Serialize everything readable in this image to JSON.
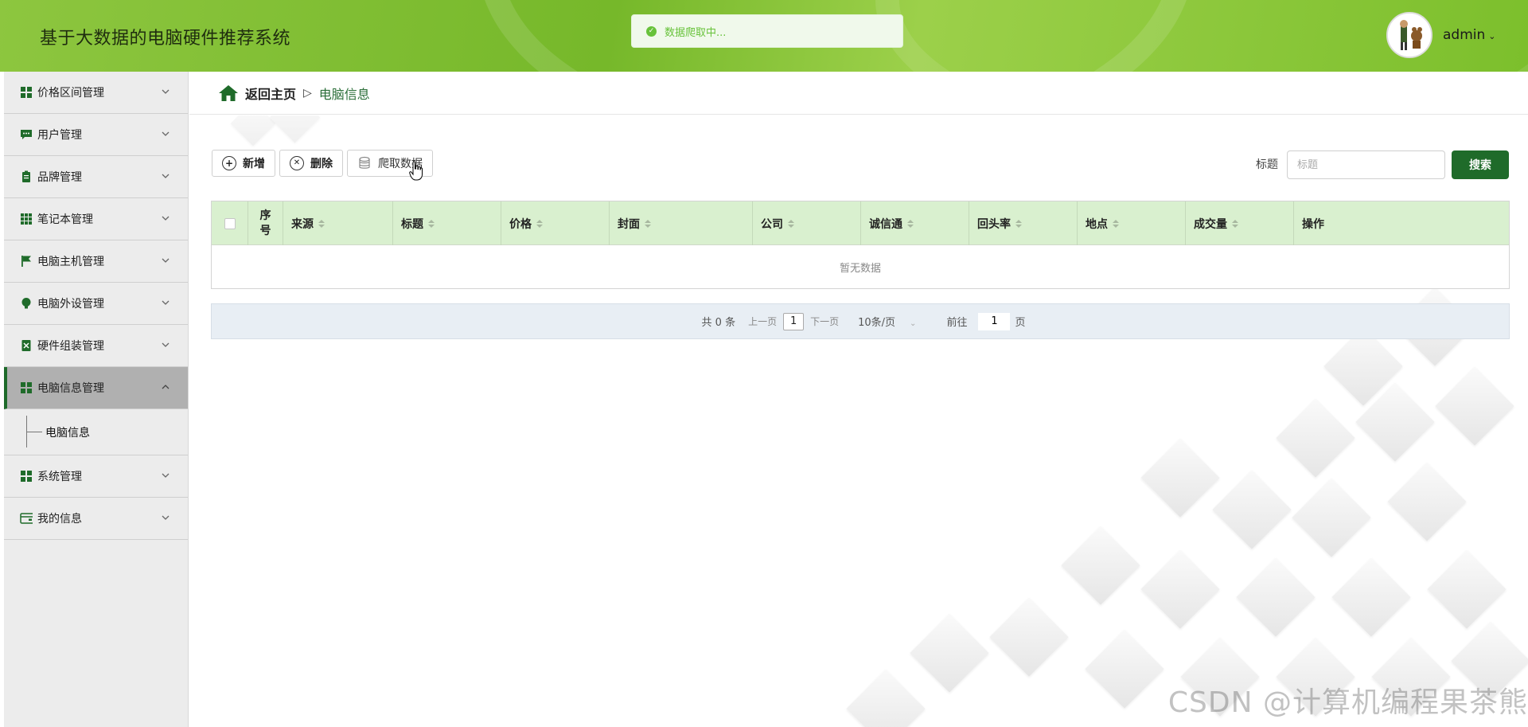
{
  "header": {
    "app_title": "基于大数据的电脑硬件推荐系统",
    "toast": "数据爬取中...",
    "user_name": "admin"
  },
  "sidebar": {
    "items": [
      {
        "label": "价格区间管理",
        "icon": "grid-icon"
      },
      {
        "label": "用户管理",
        "icon": "chat-icon"
      },
      {
        "label": "品牌管理",
        "icon": "clipboard-icon"
      },
      {
        "label": "笔记本管理",
        "icon": "apps-icon"
      },
      {
        "label": "电脑主机管理",
        "icon": "flag-icon"
      },
      {
        "label": "电脑外设管理",
        "icon": "bulb-icon"
      },
      {
        "label": "硬件组装管理",
        "icon": "doc-icon"
      },
      {
        "label": "电脑信息管理",
        "icon": "grid-icon"
      },
      {
        "label": "系统管理",
        "icon": "grid-icon"
      },
      {
        "label": "我的信息",
        "icon": "wallet-icon"
      }
    ],
    "sub_item": "电脑信息"
  },
  "breadcrumb": {
    "home": "返回主页",
    "separator": "▷",
    "current": "电脑信息"
  },
  "toolbar": {
    "add": "新增",
    "delete": "删除",
    "crawl": "爬取数据"
  },
  "search": {
    "label": "标题",
    "placeholder": "标题",
    "button": "搜索"
  },
  "table": {
    "seq_line1": "序",
    "seq_line2": "号",
    "columns": [
      "来源",
      "标题",
      "价格",
      "封面",
      "公司",
      "诚信通",
      "回头率",
      "地点",
      "成交量",
      "操作"
    ],
    "empty_text": "暂无数据"
  },
  "pager": {
    "total": "共 0 条",
    "prev": "上一页",
    "page": "1",
    "next": "下一页",
    "page_size": "10条/页",
    "goto_label": "前往",
    "goto_value": "1",
    "goto_unit": "页"
  },
  "watermark": "CSDN @计算机编程果茶熊",
  "colors": {
    "header_green": "#7cbf2c",
    "primary": "#1f6b2a",
    "table_header": "#d9f0cf",
    "toast_green": "#67c23a"
  }
}
